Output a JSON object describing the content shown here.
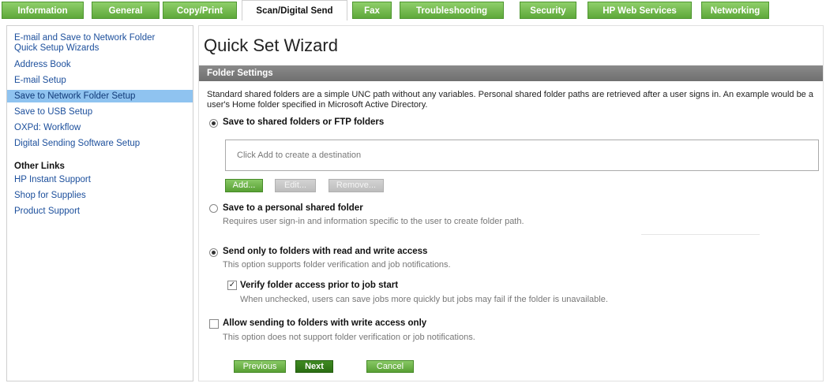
{
  "tabs": [
    {
      "label": "Information",
      "active": false
    },
    {
      "label": "General",
      "active": false
    },
    {
      "label": "Copy/Print",
      "active": false
    },
    {
      "label": "Scan/Digital Send",
      "active": true
    },
    {
      "label": "Fax",
      "active": false
    },
    {
      "label": "Troubleshooting",
      "active": false
    },
    {
      "label": "Security",
      "active": false
    },
    {
      "label": "HP Web Services",
      "active": false
    },
    {
      "label": "Networking",
      "active": false
    }
  ],
  "sidebar": {
    "items": [
      {
        "label": "E-mail and Save to Network Folder"
      },
      {
        "label": "Quick Setup Wizards"
      },
      {
        "label": "Address Book"
      },
      {
        "label": "E-mail Setup"
      },
      {
        "label": "Save to Network Folder Setup",
        "selected": true
      },
      {
        "label": "Save to USB Setup"
      },
      {
        "label": "OXPd: Workflow"
      },
      {
        "label": "Digital Sending Software Setup"
      }
    ],
    "other_links_heading": "Other Links",
    "other_links": [
      {
        "label": "HP Instant Support"
      },
      {
        "label": "Shop for Supplies"
      },
      {
        "label": "Product Support"
      }
    ]
  },
  "main": {
    "title": "Quick Set Wizard",
    "section_title": "Folder Settings",
    "description": "Standard shared folders are a simple UNC path without any variables. Personal shared folder paths are retrieved after a user signs in. An example would be a user's Home folder specified in Microsoft Active Directory.",
    "option_shared": {
      "label": "Save to shared folders or FTP folders",
      "selected": true
    },
    "destination_placeholder": "Click Add to create a destination",
    "add_button": "Add...",
    "edit_button": "Edit...",
    "remove_button": "Remove...",
    "option_personal": {
      "label": "Save to a personal shared folder",
      "sub": "Requires user sign-in and information specific to the user to create folder path.",
      "selected": false
    },
    "option_readwrite": {
      "label": "Send only to folders with read and write access",
      "sub": "This option supports folder verification and job notifications.",
      "selected": true
    },
    "verify_access": {
      "label": "Verify folder access prior to job start",
      "sub": "When unchecked, users can save jobs more quickly but jobs may fail if the folder is unavailable.",
      "checked": true
    },
    "allow_write_only": {
      "label": "Allow sending to folders with write access only",
      "sub": "This option does not support folder verification or job notifications.",
      "checked": false
    },
    "previous_button": "Previous",
    "next_button": "Next",
    "cancel_button": "Cancel"
  },
  "colors": {
    "tab_green": "#5ea83a",
    "link_blue": "#1c4f9c",
    "selected_nav": "#8fc3f0",
    "section_bar": "#7a7a7a"
  }
}
